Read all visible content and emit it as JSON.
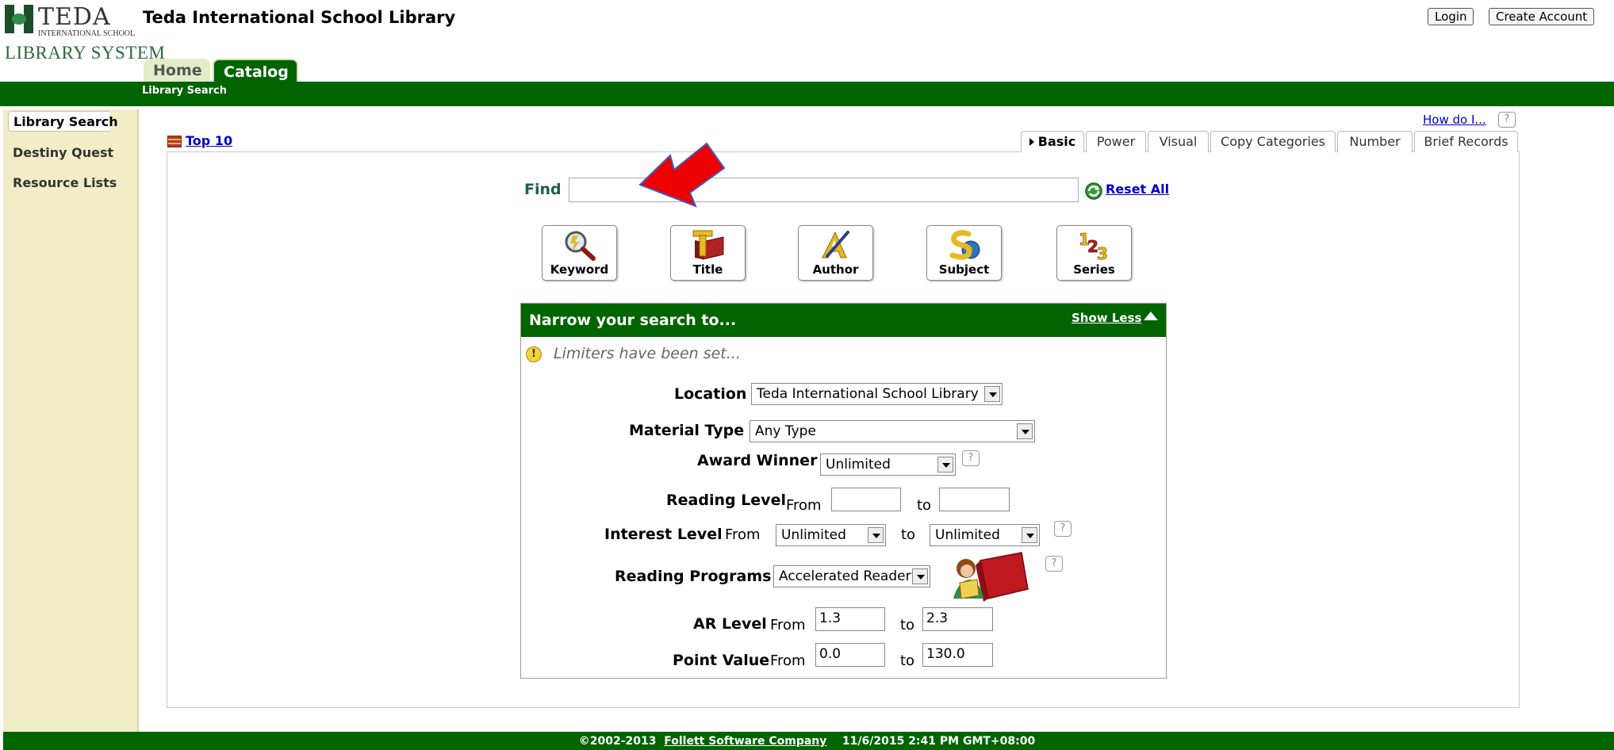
{
  "logo": {
    "name": "TEDA",
    "subline": "INTERNATIONAL SCHOOL",
    "system": "LIBRARY SYSTEM"
  },
  "site_title": "Teda International School Library",
  "account": {
    "login": "Login",
    "create": "Create Account"
  },
  "nav_tabs": [
    {
      "label": "Home"
    },
    {
      "label": "Catalog"
    }
  ],
  "subnav": {
    "current": "Library Search"
  },
  "sidebar": {
    "items": [
      {
        "label": "Library Search"
      },
      {
        "label": "Destiny Quest"
      },
      {
        "label": "Resource Lists"
      }
    ]
  },
  "help": {
    "how_do_i": "How do I...",
    "help_mark": "?"
  },
  "top10": "Top 10",
  "search_tabs": [
    {
      "label": "Basic"
    },
    {
      "label": "Power"
    },
    {
      "label": "Visual"
    },
    {
      "label": "Copy Categories"
    },
    {
      "label": "Number"
    },
    {
      "label": "Brief Records"
    }
  ],
  "find": {
    "label": "Find",
    "value": "",
    "reset": "Reset All"
  },
  "search_buttons": [
    {
      "label": "Keyword",
      "icon": "keyword-magnifier-icon"
    },
    {
      "label": "Title",
      "icon": "title-book-icon"
    },
    {
      "label": "Author",
      "icon": "author-pen-icon"
    },
    {
      "label": "Subject",
      "icon": "subject-globe-icon"
    },
    {
      "label": "Series",
      "icon": "series-numbers-icon"
    }
  ],
  "narrow": {
    "title": "Narrow your search to...",
    "show_less": "Show Less",
    "notice": "Limiters have been set...",
    "location": {
      "label": "Location",
      "value": "Teda International School Library"
    },
    "material_type": {
      "label": "Material Type",
      "value": "Any Type"
    },
    "award_winner": {
      "label": "Award Winner",
      "value": "Unlimited"
    },
    "reading_level": {
      "label": "Reading Level",
      "from": "From",
      "to": "to",
      "from_value": "",
      "to_value": ""
    },
    "interest_level": {
      "label": "Interest Level",
      "from": "From",
      "to": "to",
      "from_value": "Unlimited",
      "to_value": "Unlimited"
    },
    "reading_programs": {
      "label": "Reading Programs",
      "value": "Accelerated Reader"
    },
    "ar_level": {
      "label": "AR Level",
      "from": "From",
      "to": "to",
      "from_value": "1.3",
      "to_value": "2.3"
    },
    "point_value": {
      "label": "Point Value",
      "from": "From",
      "to": "to",
      "from_value": "0.0",
      "to_value": "130.0"
    }
  },
  "footer": {
    "copyright": "©2002-2013",
    "company": "Follett Software Company",
    "timestamp": "11/6/2015 2:41 PM GMT+08:00"
  },
  "colors": {
    "brand_green": "#006400",
    "sidebar_bg": "#f1edc7",
    "link_blue": "#0000cc",
    "annotation_arrow": "#ee0000"
  }
}
